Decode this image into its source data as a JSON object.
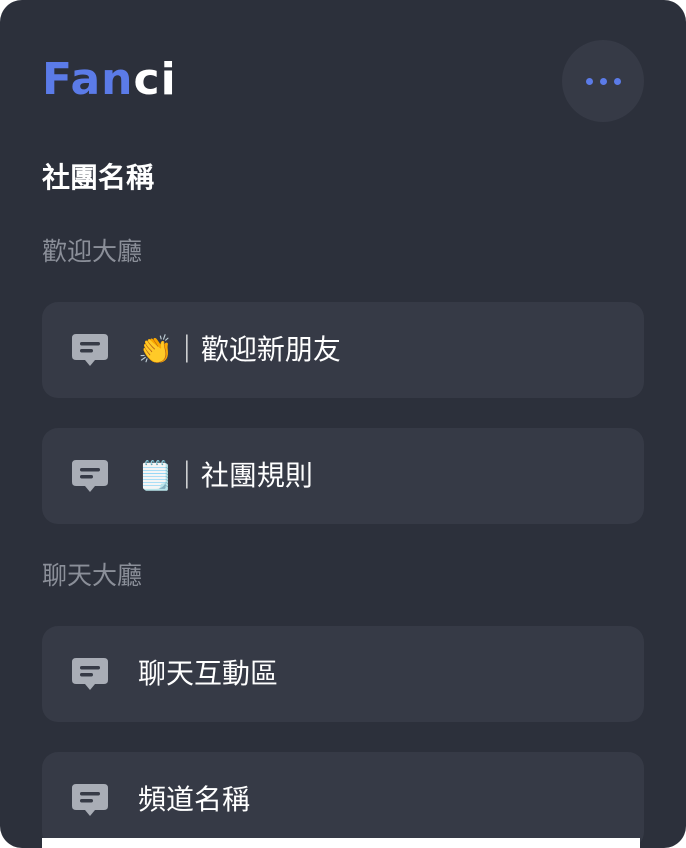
{
  "brand": {
    "logo_blue": "Fan",
    "logo_white": "ci"
  },
  "header": {
    "more_button_label": "more-options"
  },
  "community": {
    "name": "社團名稱"
  },
  "sections": [
    {
      "label": "歡迎大廳",
      "channels": [
        {
          "label": "👏｜歡迎新朋友",
          "icon": "chat-bubble-icon"
        },
        {
          "label": "🗒️｜社團規則",
          "icon": "chat-bubble-icon"
        }
      ]
    },
    {
      "label": "聊天大廳",
      "channels": [
        {
          "label": "聊天互動區",
          "icon": "chat-bubble-icon"
        },
        {
          "label": "頻道名稱",
          "icon": "chat-bubble-icon"
        }
      ]
    }
  ],
  "colors": {
    "panel_bg": "#2c303b",
    "card_bg": "#363a46",
    "accent": "#5b7be8",
    "icon_gray": "#a9adb6",
    "muted_text": "#8b8f99"
  }
}
